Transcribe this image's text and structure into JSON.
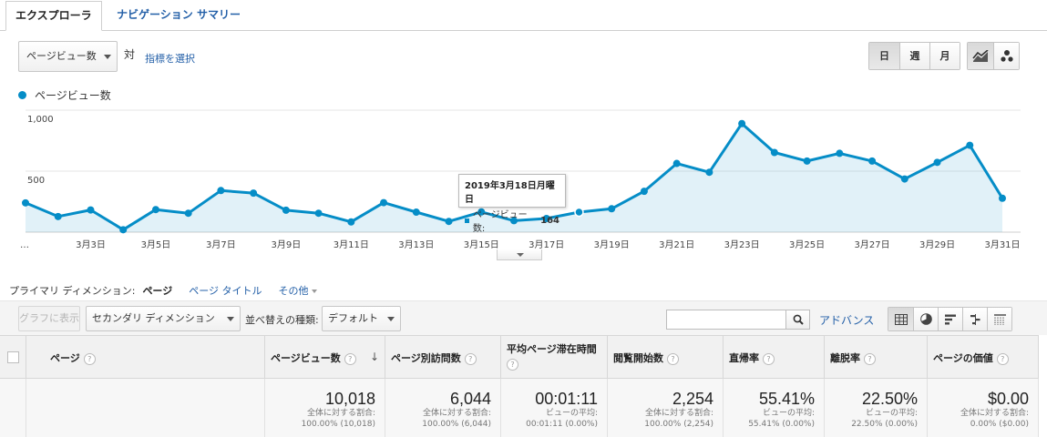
{
  "tabs": {
    "explorer": "エクスプローラ",
    "nav_summary": "ナビゲーション サマリー"
  },
  "controls": {
    "metric": "ページビュー数",
    "vs": "対",
    "choose_metric": "指標を選択",
    "periods": [
      "日",
      "週",
      "月"
    ]
  },
  "legend": {
    "series": "ページビュー数"
  },
  "colors": {
    "accent": "#058dc7",
    "link": "#2460a8"
  },
  "chart_data": {
    "type": "area",
    "title": "",
    "xlabel": "",
    "ylabel": "",
    "ylim": [
      0,
      1000
    ],
    "yticks": [
      {
        "value": 500,
        "label": "500"
      },
      {
        "value": 1000,
        "label": "1,000"
      }
    ],
    "dates": [
      "3月1日",
      "3月2日",
      "3月3日",
      "3月4日",
      "3月5日",
      "3月6日",
      "3月7日",
      "3月8日",
      "3月9日",
      "3月10日",
      "3月11日",
      "3月12日",
      "3月13日",
      "3月14日",
      "3月15日",
      "3月16日",
      "3月17日",
      "3月18日",
      "3月19日",
      "3月20日",
      "3月21日",
      "3月22日",
      "3月23日",
      "3月24日",
      "3月25日",
      "3月26日",
      "3月27日",
      "3月28日",
      "3月29日",
      "3月30日",
      "3月31日"
    ],
    "xtick_labels": [
      "…",
      "3月3日",
      "3月5日",
      "3月7日",
      "3月9日",
      "3月11日",
      "3月13日",
      "3月15日",
      "3月17日",
      "3月19日",
      "3月21日",
      "3月23日",
      "3月25日",
      "3月27日",
      "3月29日",
      "3月31日"
    ],
    "series": [
      {
        "name": "ページビュー数",
        "values": [
          240,
          128,
          182,
          20,
          185,
          155,
          341,
          320,
          180,
          155,
          84,
          242,
          164,
          88,
          166,
          94,
          112,
          164,
          192,
          335,
          563,
          491,
          890,
          653,
          583,
          646,
          583,
          436,
          572,
          712,
          278
        ]
      }
    ]
  },
  "tooltip": {
    "date": "2019年3月18日月曜日",
    "label": "ページビュー数:",
    "value": "164"
  },
  "dimension": {
    "label": "プライマリ ディメンション:",
    "current": "ページ",
    "page_title": "ページ タイトル",
    "other": "その他"
  },
  "toolbar": {
    "plot_rows": "グラフに表示",
    "secondary_dimension": "セカンダリ ディメンション",
    "sort_label": "並べ替えの種類:",
    "sort_value": "デフォルト",
    "search_value": "",
    "advanced": "アドバンス"
  },
  "table": {
    "headers": [
      "ページ",
      "ページビュー数",
      "ページ別訪問数",
      "平均ページ滞在時間",
      "閲覧開始数",
      "直帰率",
      "離脱率",
      "ページの価値"
    ],
    "totals": [
      {
        "value": "10,018",
        "sub1": "全体に対する割合:",
        "sub2": "100.00% (10,018)"
      },
      {
        "value": "6,044",
        "sub1": "全体に対する割合:",
        "sub2": "100.00% (6,044)"
      },
      {
        "value": "00:01:11",
        "sub1": "ビューの平均:",
        "sub2": "00:01:11 (0.00%)"
      },
      {
        "value": "2,254",
        "sub1": "全体に対する割合:",
        "sub2": "100.00% (2,254)"
      },
      {
        "value": "55.41%",
        "sub1": "ビューの平均:",
        "sub2": "55.41% (0.00%)"
      },
      {
        "value": "22.50%",
        "sub1": "ビューの平均:",
        "sub2": "22.50% (0.00%)"
      },
      {
        "value": "$0.00",
        "sub1": "全体に対する割合:",
        "sub2": "0.00% ($0.00)"
      }
    ]
  }
}
